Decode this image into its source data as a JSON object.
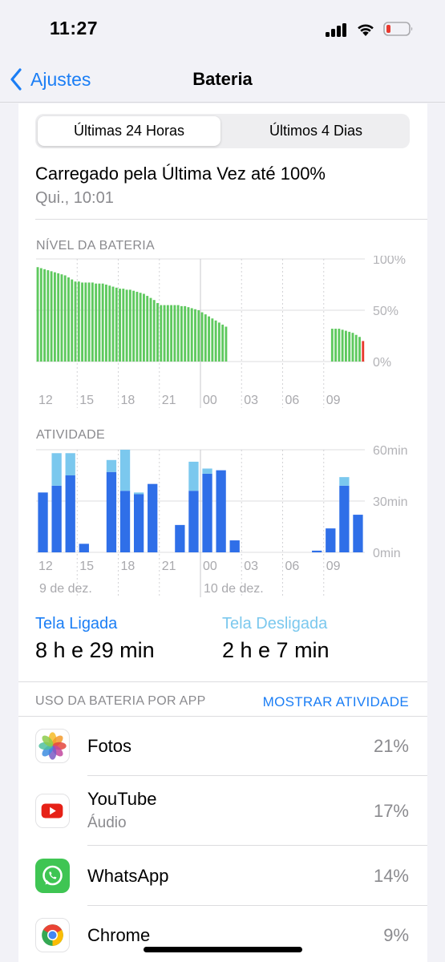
{
  "status_bar": {
    "time": "11:27"
  },
  "nav": {
    "back_label": "Ajustes",
    "title": "Bateria"
  },
  "segments": {
    "active": "Últimas 24 Horas",
    "inactive": "Últimos 4 Dias"
  },
  "charge": {
    "title": "Carregado pela Última Vez até 100%",
    "subtitle": "Qui., 10:01"
  },
  "colors": {
    "accent": "#1b7ef5",
    "screen_on": "#2f6fe8",
    "screen_off": "#7bc8ee",
    "battery_green": "#5ec95e",
    "battery_low": "#e8392e"
  },
  "chart_data": [
    {
      "type": "bar",
      "title": "NÍVEL DA BATERIA",
      "ylim": [
        0,
        100
      ],
      "y_ticks": [
        "100%",
        "50%",
        "0%"
      ],
      "x_tick_labels": [
        "12",
        "15",
        "18",
        "21",
        "00",
        "03",
        "06",
        "09"
      ],
      "grid": true,
      "values": [
        92,
        91,
        90,
        89,
        88,
        87,
        86,
        85,
        84,
        82,
        80,
        78,
        78,
        77,
        77,
        77,
        77,
        76,
        76,
        76,
        75,
        74,
        73,
        72,
        71,
        71,
        70,
        70,
        69,
        68,
        67,
        66,
        64,
        62,
        60,
        57,
        55,
        55,
        55,
        55,
        55,
        55,
        54,
        54,
        53,
        52,
        51,
        50,
        48,
        46,
        44,
        42,
        40,
        38,
        36,
        34,
        0,
        0,
        0,
        0,
        0,
        0,
        0,
        0,
        0,
        0,
        0,
        0,
        0,
        0,
        0,
        0,
        0,
        0,
        0,
        0,
        0,
        0,
        0,
        0,
        0,
        0,
        0,
        0,
        0,
        0,
        32,
        32,
        32,
        31,
        30,
        29,
        28,
        26,
        24,
        20
      ]
    },
    {
      "type": "bar",
      "title": "ATIVIDADE",
      "ylim": [
        0,
        60
      ],
      "y_ticks": [
        "60min",
        "30min",
        "0min"
      ],
      "x_tick_labels": [
        "12",
        "15",
        "18",
        "21",
        "00",
        "03",
        "06",
        "09"
      ],
      "date_labels": [
        "9 de dez.",
        "10 de dez."
      ],
      "grid": true,
      "series": [
        {
          "name": "Tela Ligada",
          "values": [
            35,
            39,
            45,
            5,
            0,
            47,
            36,
            34,
            40,
            0,
            16,
            36,
            46,
            48,
            7,
            0,
            0,
            0,
            0,
            0,
            1,
            14,
            39,
            22
          ]
        },
        {
          "name": "Tela Desligada",
          "values": [
            0,
            19,
            13,
            0,
            0,
            7,
            24,
            1,
            0,
            0,
            0,
            17,
            3,
            0,
            0,
            0,
            0,
            0,
            0,
            0,
            0,
            0,
            5,
            0
          ]
        }
      ]
    }
  ],
  "legend": {
    "on_label": "Tela Ligada",
    "on_value": "8 h e 29 min",
    "off_label": "Tela Desligada",
    "off_value": "2 h e 7 min"
  },
  "usage": {
    "label": "USO DA BATERIA POR APP",
    "show_activity": "MOSTRAR ATIVIDADE",
    "apps": [
      {
        "name": "Fotos",
        "sub": "",
        "pct": "21%",
        "icon": "photos-icon"
      },
      {
        "name": "YouTube",
        "sub": "Áudio",
        "pct": "17%",
        "icon": "youtube-icon"
      },
      {
        "name": "WhatsApp",
        "sub": "",
        "pct": "14%",
        "icon": "whatsapp-icon"
      },
      {
        "name": "Chrome",
        "sub": "",
        "pct": "9%",
        "icon": "chrome-icon"
      }
    ]
  }
}
